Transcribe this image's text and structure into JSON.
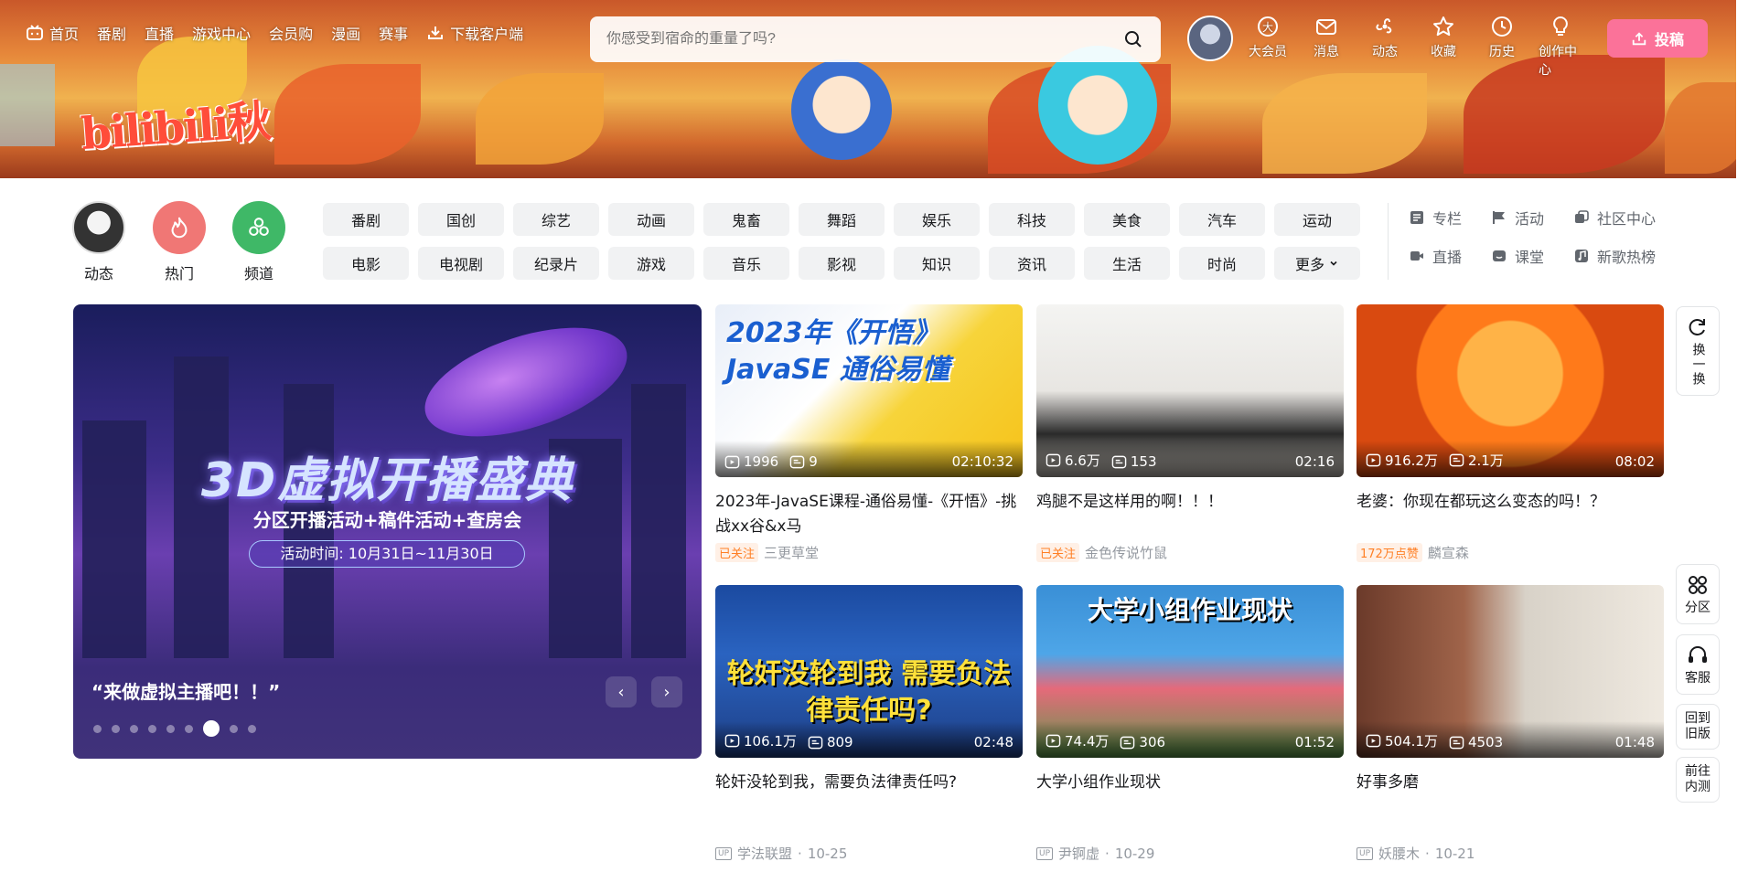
{
  "header": {
    "nav": [
      {
        "label": "首页",
        "icon": "tv-icon"
      },
      {
        "label": "番剧"
      },
      {
        "label": "直播"
      },
      {
        "label": "游戏中心"
      },
      {
        "label": "会员购"
      },
      {
        "label": "漫画"
      },
      {
        "label": "赛事"
      },
      {
        "label": "下载客户端",
        "icon": "download-icon"
      }
    ],
    "search_placeholder": "你感受到宿命的重量了吗?",
    "logo_text": "bilibili秋",
    "right_nav": [
      {
        "label": "大会员",
        "icon": "vip-icon"
      },
      {
        "label": "消息",
        "icon": "mail-icon"
      },
      {
        "label": "动态",
        "icon": "dynamic-icon"
      },
      {
        "label": "收藏",
        "icon": "star-icon"
      },
      {
        "label": "历史",
        "icon": "clock-icon"
      },
      {
        "label": "创作中心",
        "icon": "bulb-icon"
      }
    ],
    "upload_label": "投稿"
  },
  "channel_bar": {
    "big": [
      {
        "label": "动态",
        "color": "#555"
      },
      {
        "label": "热门",
        "color": "#f07775"
      },
      {
        "label": "频道",
        "color": "#3fb867"
      }
    ],
    "channels": [
      "番剧",
      "国创",
      "综艺",
      "动画",
      "鬼畜",
      "舞蹈",
      "娱乐",
      "科技",
      "美食",
      "汽车",
      "运动",
      "电影",
      "电视剧",
      "纪录片",
      "游戏",
      "音乐",
      "影视",
      "知识",
      "资讯",
      "生活",
      "时尚",
      "更多"
    ],
    "side_links": [
      {
        "label": "专栏",
        "icon": "column-icon"
      },
      {
        "label": "活动",
        "icon": "flag-icon"
      },
      {
        "label": "社区中心",
        "icon": "community-icon"
      },
      {
        "label": "直播",
        "icon": "live-icon"
      },
      {
        "label": "课堂",
        "icon": "class-icon"
      },
      {
        "label": "新歌热榜",
        "icon": "music-icon"
      }
    ]
  },
  "carousel": {
    "title": "3D虚拟开播盛典",
    "subtitle": "分区开播活动+稿件活动+查房会",
    "date": "活动时间: 10月31日~11月30日",
    "caption": "“来做虚拟主播吧！！”",
    "dot_count": 9,
    "active_dot": 6,
    "prev": "‹",
    "next": "›"
  },
  "videos": [
    {
      "title": "2023年-JavaSE课程-通俗易懂-《开悟》-挑战xx谷&x马",
      "plays": "1996",
      "danmaku": "9",
      "duration": "02:10:32",
      "tag": "已关注",
      "author": "三更草堂",
      "date": "",
      "thumb_text": "2023年《开悟》JavaSE 通俗易懂"
    },
    {
      "title": "鸡腿不是这样用的啊！！！",
      "plays": "6.6万",
      "danmaku": "153",
      "duration": "02:16",
      "tag": "已关注",
      "author": "金色传说竹鼠",
      "date": "",
      "thumb_text": ""
    },
    {
      "title": "老婆：你现在都玩这么变态的吗！？",
      "plays": "916.2万",
      "danmaku": "2.1万",
      "duration": "08:02",
      "tag": "172万点赞",
      "author": "麟宣森",
      "date": "",
      "thumb_text": ""
    },
    {
      "title": "轮奸没轮到我，需要负法律责任吗?",
      "plays": "106.1万",
      "danmaku": "809",
      "duration": "02:48",
      "tag": "",
      "author": "学法联盟",
      "date": "10-25",
      "thumb_text": "轮奸没轮到我 需要负法律责任吗?"
    },
    {
      "title": "大学小组作业现状",
      "plays": "74.4万",
      "danmaku": "306",
      "duration": "01:52",
      "tag": "",
      "author": "尹锕虚",
      "date": "10-29",
      "thumb_text": "大学小组作业现状"
    },
    {
      "title": "好事多磨",
      "plays": "504.1万",
      "danmaku": "4503",
      "duration": "01:48",
      "tag": "",
      "author": "妖腰木",
      "date": "10-21",
      "thumb_text": ""
    }
  ],
  "float": {
    "refresh": "换一换",
    "zone": "分区",
    "service": "客服",
    "old": "回到旧版",
    "beta": "前往内测"
  }
}
